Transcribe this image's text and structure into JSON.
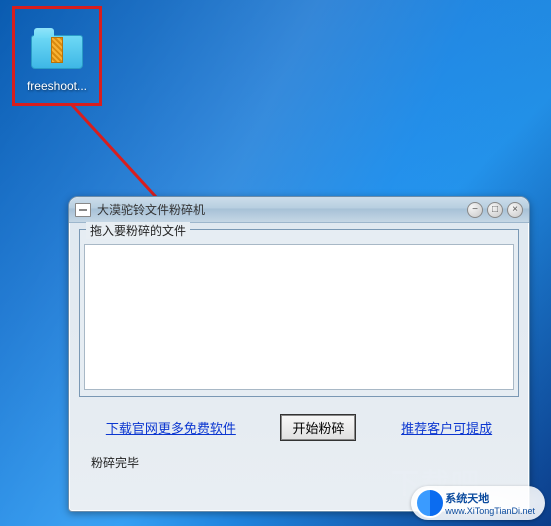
{
  "desktop": {
    "icon_label": "freeshoot..."
  },
  "window": {
    "title": "大漠驼铃文件粉碎机",
    "drop_label": "拖入要粉碎的文件",
    "link_download": "下载官网更多免费软件",
    "button_start": "开始粉碎",
    "link_recommend": "推荐客户可提成",
    "status": "粉碎完毕",
    "titlebar_buttons": {
      "minimize": "−",
      "maximize": "□",
      "close": "×"
    }
  },
  "watermark": {
    "title": "系统天地",
    "url": "www.XiTongTianDi.net"
  },
  "colors": {
    "highlight_border": "#d81e1e",
    "arrow": "#d81e1e",
    "link": "#0b36d0"
  }
}
